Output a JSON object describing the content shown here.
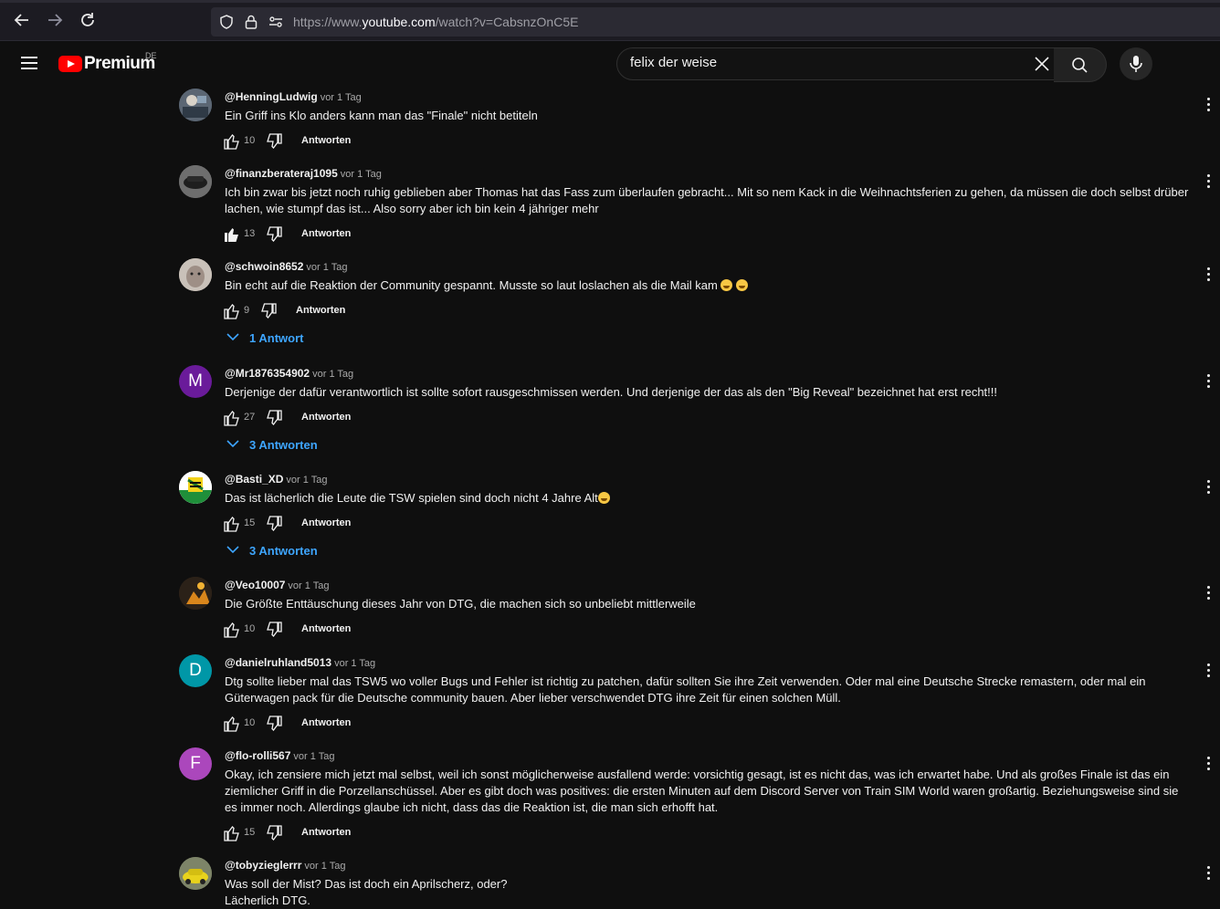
{
  "browser": {
    "url_prefix": "https://www.",
    "url_host": "youtube.com",
    "url_path": "/watch?v=CabsnzOnC5E"
  },
  "header": {
    "logo_text": "Premium",
    "country_code": "DE",
    "search_value": "felix der weise"
  },
  "comments": [
    {
      "author": "@HenningLudwig",
      "time": "vor 1 Tag",
      "text": "Ein Griff ins Klo anders kann man das \"Finale\" nicht betiteln",
      "likes": "10",
      "reply_label": "Antworten"
    },
    {
      "author": "@finanzberateraj1095",
      "time": "vor 1 Tag",
      "text": "Ich bin zwar bis jetzt noch ruhig geblieben aber Thomas hat das Fass zum überlaufen gebracht... Mit so nem Kack in die Weihnachtsferien zu gehen, da müssen die doch selbst drüber lachen, wie stumpf das ist... Also sorry aber ich bin kein 4 jähriger mehr",
      "likes": "13",
      "reply_label": "Antworten",
      "liked": true
    },
    {
      "author": "@schwoin8652",
      "time": "vor 1 Tag",
      "text": "Bin echt auf die Reaktion der Community gespannt. Musste so laut loslachen als die Mail kam",
      "likes": "9",
      "reply_label": "Antworten",
      "replies": "1 Antwort"
    },
    {
      "author": "@Mr1876354902",
      "time": "vor 1 Tag",
      "text": "Derjenige der dafür verantwortlich ist sollte sofort rausgeschmissen werden. Und derjenige der das als den \"Big Reveal\" bezeichnet hat erst recht!!!",
      "likes": "27",
      "reply_label": "Antworten",
      "replies": "3 Antworten",
      "avatar_letter": "M",
      "avatar_color": "#6a1b9a"
    },
    {
      "author": "@Basti_XD",
      "time": "vor 1 Tag",
      "text": "Das ist lächerlich die Leute die TSW spielen sind doch nicht 4 Jahre Alt",
      "likes": "15",
      "reply_label": "Antworten",
      "replies": "3 Antworten"
    },
    {
      "author": "@Veo10007",
      "time": "vor 1 Tag",
      "text": "Die Größte Enttäuschung dieses Jahr von DTG, die machen sich so unbeliebt mittlerweile",
      "likes": "10",
      "reply_label": "Antworten"
    },
    {
      "author": "@danielruhland5013",
      "time": "vor 1 Tag",
      "text": "Dtg sollte lieber mal das TSW5 wo voller Bugs und Fehler ist richtig zu patchen, dafür sollten Sie ihre Zeit verwenden. Oder mal eine Deutsche Strecke remastern, oder mal ein Güterwagen pack für die Deutsche community bauen. Aber lieber verschwendet DTG ihre Zeit für einen solchen Müll.",
      "likes": "10",
      "reply_label": "Antworten",
      "avatar_letter": "D",
      "avatar_color": "#0097a7"
    },
    {
      "author": "@flo-rolli567",
      "time": "vor 1 Tag",
      "text": "Okay, ich zensiere mich jetzt mal selbst, weil ich sonst möglicherweise ausfallend werde: vorsichtig gesagt, ist es nicht das, was ich erwartet habe. Und als großes Finale ist das ein ziemlicher Griff in die Porzellanschüssel. Aber es gibt doch was positives: die ersten Minuten auf dem Discord Server von Train SIM  World waren großartig. Beziehungsweise sind sie es immer noch. Allerdings glaube ich nicht, dass das die Reaktion ist, die man sich erhofft hat.",
      "likes": "15",
      "reply_label": "Antworten",
      "avatar_letter": "F",
      "avatar_color": "#ab47bc"
    },
    {
      "author": "@tobyzieglerrr",
      "time": "vor 1 Tag",
      "text_line1": "Was soll der Mist? Das ist doch ein Aprilscherz, oder?",
      "text_line2": "Lächerlich DTG."
    }
  ]
}
